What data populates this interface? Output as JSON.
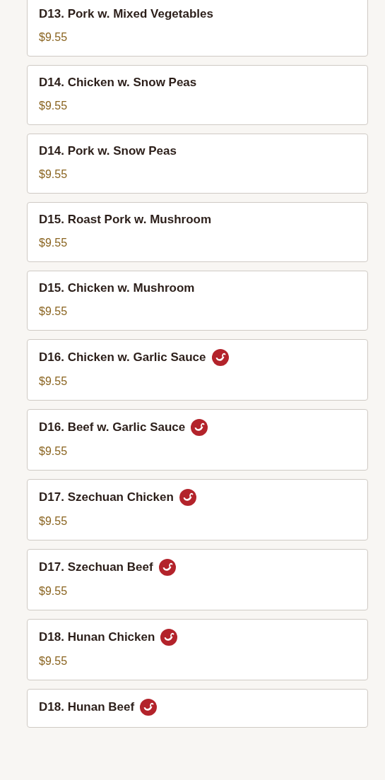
{
  "items": [
    {
      "name": "D13. Pork w. Mixed Vegetables",
      "price": "$9.55",
      "spicy": false
    },
    {
      "name": "D14. Chicken w. Snow Peas",
      "price": "$9.55",
      "spicy": false
    },
    {
      "name": "D14. Pork w. Snow Peas",
      "price": "$9.55",
      "spicy": false
    },
    {
      "name": "D15. Roast Pork w. Mushroom",
      "price": "$9.55",
      "spicy": false
    },
    {
      "name": "D15. Chicken w. Mushroom",
      "price": "$9.55",
      "spicy": false
    },
    {
      "name": "D16. Chicken w. Garlic Sauce",
      "price": "$9.55",
      "spicy": true
    },
    {
      "name": "D16. Beef w. Garlic Sauce",
      "price": "$9.55",
      "spicy": true
    },
    {
      "name": "D17. Szechuan Chicken",
      "price": "$9.55",
      "spicy": true
    },
    {
      "name": "D17. Szechuan Beef",
      "price": "$9.55",
      "spicy": true
    },
    {
      "name": "D18. Hunan Chicken",
      "price": "$9.55",
      "spicy": true
    },
    {
      "name": "D18. Hunan Beef",
      "spicy": true
    }
  ]
}
